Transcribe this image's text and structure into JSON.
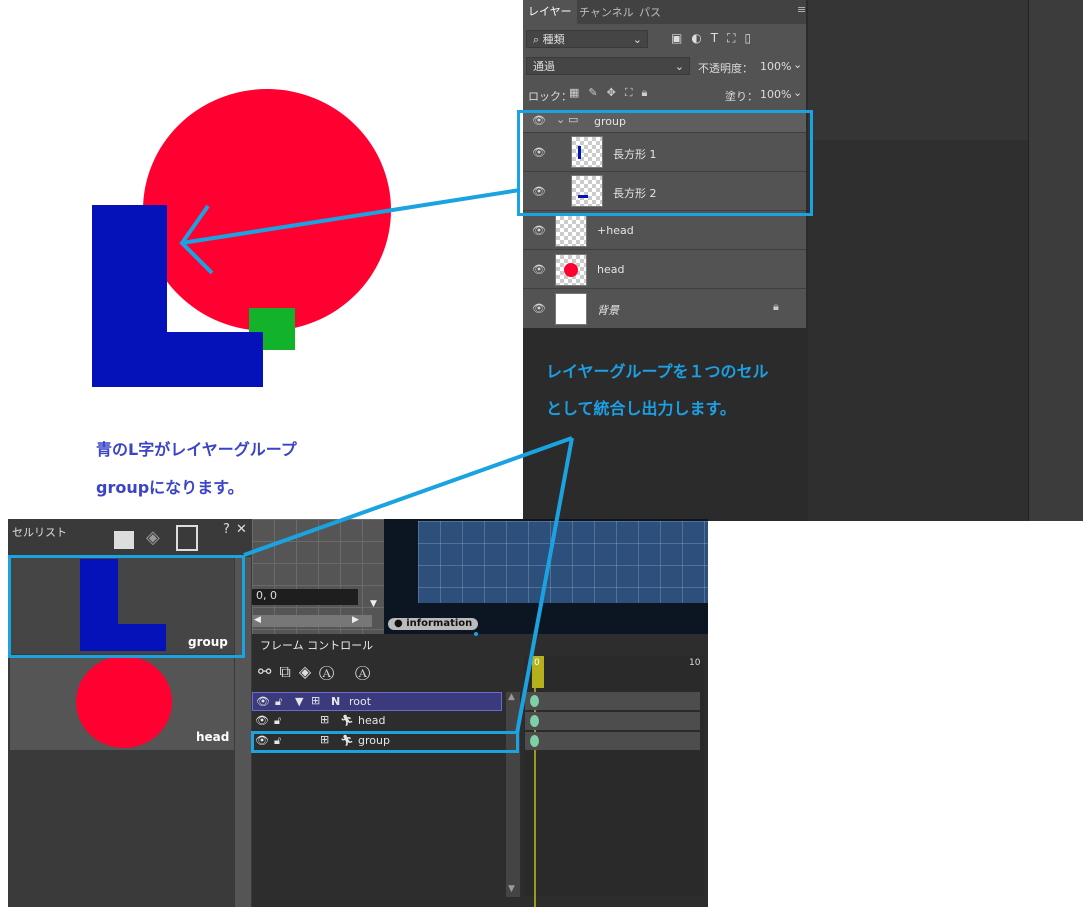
{
  "layers_panel": {
    "tabs": [
      "レイヤー",
      "チャンネル",
      "パス"
    ],
    "filter_label": "種類",
    "blend_mode": "通過",
    "opacity_label": "不透明度：",
    "opacity_value": "100%",
    "lock_label": "ロック：",
    "fill_label": "塗り：",
    "fill_value": "100%",
    "layers": [
      {
        "name": "group",
        "type": "group"
      },
      {
        "name": "長方形 1",
        "type": "shape"
      },
      {
        "name": "長方形 2",
        "type": "shape"
      },
      {
        "name": "+head",
        "type": "layer"
      },
      {
        "name": "head",
        "type": "shape"
      },
      {
        "name": "背景",
        "type": "background"
      }
    ]
  },
  "annotations": {
    "callout_1": "レイヤーグループを１つのセル",
    "callout_2": "として統合し出力します。",
    "note_1": "青のL字がレイヤーグループ",
    "note_2": "groupになります。"
  },
  "cell_list": {
    "title": "セルリスト",
    "help": "?",
    "close": "✕",
    "cells": [
      {
        "label": "group"
      },
      {
        "label": "head"
      }
    ]
  },
  "preview": {
    "coords": "0, 0"
  },
  "timeline": {
    "info_tab": "information",
    "frame_control_title": "フレーム コントロール",
    "frame_marker_start": "0",
    "frame_marker_end": "10",
    "tracks": [
      {
        "name": "root",
        "flag": "N"
      },
      {
        "name": "head"
      },
      {
        "name": "group"
      }
    ]
  },
  "colors": {
    "accent": "#1aa3e0",
    "red": "#ff0030",
    "blue": "#0511b9",
    "green": "#12b32a"
  }
}
